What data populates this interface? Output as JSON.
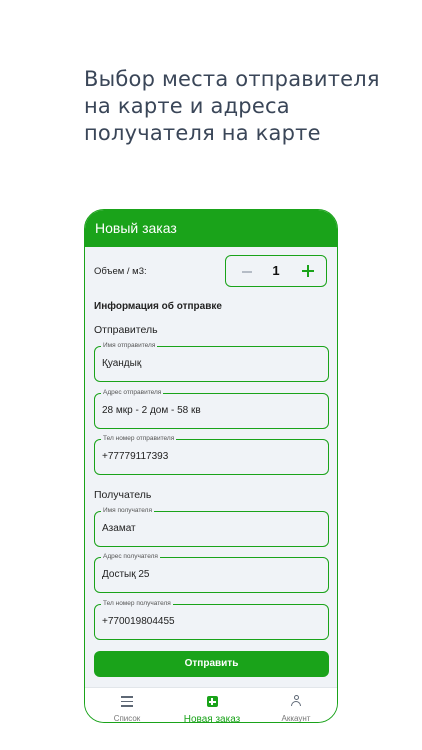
{
  "headline": {
    "line1": "Выбор места отправителя",
    "line2": "на карте и адреса",
    "line3": "получателя на карте"
  },
  "topbar": {
    "title": "Новый заказ"
  },
  "volume": {
    "label": "Объем / м3:",
    "quantity": "1"
  },
  "shipping": {
    "section_title": "Информация об отправке"
  },
  "sender": {
    "title": "Отправитель",
    "name_label": "Имя отправителя",
    "name_value": "Қуандық",
    "address_label": "Адрес отправителя",
    "address_value": "28 мкр - 2 дом - 58 кв",
    "phone_label": "Тел номер отправителя",
    "phone_value": "+77779117393"
  },
  "recipient": {
    "title": "Получатель",
    "name_label": "Имя получателя",
    "name_value": "Азамат",
    "address_label": "Адрес получателя",
    "address_value": "Достық 25",
    "phone_label": "Тел номер получателя",
    "phone_value": "+770019804455"
  },
  "submit_label": "Отправить",
  "bottom_nav": {
    "list_label": "Список",
    "new_order_label": "Новая заказ",
    "account_label": "Аккаунт"
  },
  "colors": {
    "accent": "#1aa31a",
    "background": "#f0f3f7",
    "headline": "#3a4658"
  }
}
